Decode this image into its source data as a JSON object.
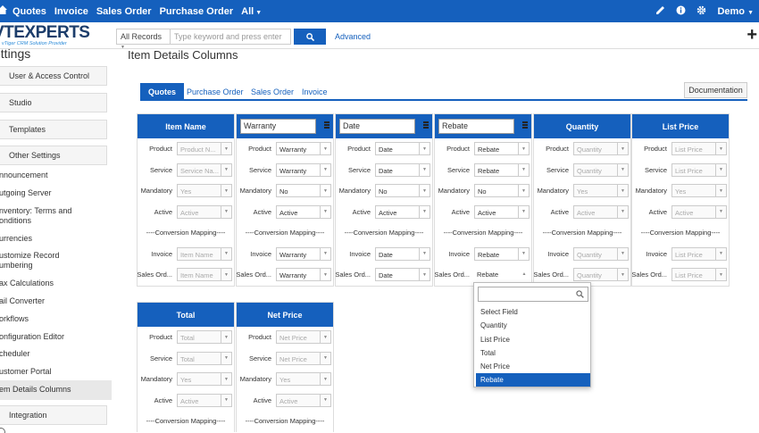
{
  "topbar": {
    "nav": [
      "Quotes",
      "Invoice",
      "Sales Order",
      "Purchase Order",
      "All"
    ],
    "user": "Demo"
  },
  "header": {
    "logo_big": "VTEXPERTS",
    "logo_small": "vTiger CRM Solution Provider",
    "search_select": "All Records",
    "search_placeholder": "Type keyword and press enter",
    "advanced": "Advanced"
  },
  "sidebar": {
    "title": "ettings",
    "boxes": [
      "User & Access Control",
      "Studio",
      "Templates",
      "Other Settings"
    ],
    "items": [
      "nnouncement",
      "utgoing Server",
      "nventory: Terms and",
      "onditions",
      "urrencies",
      "ustomize Record",
      "umbering",
      "ax Calculations",
      "ail Converter",
      "orkflows",
      "onfiguration Editor",
      "cheduler",
      "ustomer Portal",
      "em Details Columns"
    ],
    "integration": "Integration"
  },
  "main": {
    "title": "Item Details Columns",
    "tabs": [
      "Quotes",
      "Purchase Order",
      "Sales Order",
      "Invoice"
    ],
    "documentation": "Documentation",
    "conversion": "----Conversion Mapping----",
    "row_labels": [
      "Product",
      "Service",
      "Mandatory",
      "Active",
      "Invoice",
      "Sales Ord..."
    ],
    "columns": [
      {
        "header": "Item Name",
        "vals": [
          "Product N...",
          "Service Na...",
          "Yes",
          "Active",
          "Item Name",
          "Item Name"
        ]
      },
      {
        "header": "Warranty",
        "vals": [
          "Warranty",
          "Warranty",
          "No",
          "Active",
          "Warranty",
          "Warranty"
        ]
      },
      {
        "header": "Date",
        "vals": [
          "Date",
          "Date",
          "No",
          "Active",
          "Date",
          "Date"
        ]
      },
      {
        "header": "Rebate",
        "vals": [
          "Rebate",
          "Rebate",
          "No",
          "Active",
          "Rebate",
          "Rebate"
        ]
      },
      {
        "header": "Quantity",
        "vals": [
          "Quantity",
          "Quantity",
          "Yes",
          "Active",
          "Quantity",
          "Quantity"
        ]
      },
      {
        "header": "List Price",
        "vals": [
          "List Price",
          "List Price",
          "Yes",
          "Active",
          "List Price",
          "List Price"
        ]
      },
      {
        "header": "Total",
        "vals": [
          "Total",
          "Total",
          "Yes",
          "Active"
        ]
      },
      {
        "header": "Net Price",
        "vals": [
          "Net Price",
          "Net Price",
          "Yes",
          "Active"
        ]
      }
    ],
    "dropdown_options": [
      "Select Field",
      "Quantity",
      "List Price",
      "Total",
      "Net Price",
      "Rebate"
    ],
    "dropdown_selected": "Rebate"
  },
  "colors": {
    "brand": "#1560bd"
  }
}
